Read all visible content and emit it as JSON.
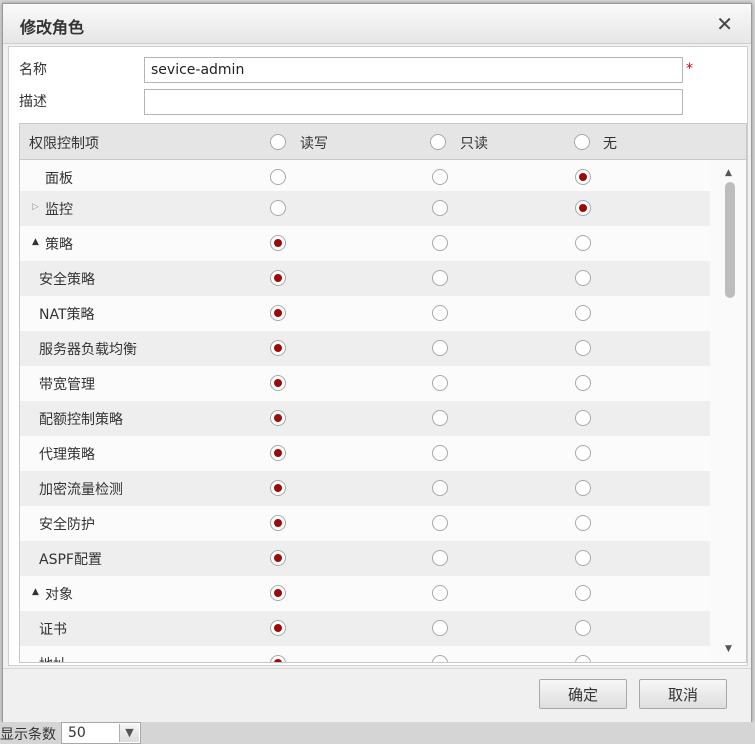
{
  "dialog": {
    "title": "修改角色",
    "close_glyph": "✕",
    "close_icon": "close-icon"
  },
  "form": {
    "name_label": "名称",
    "name_value": "sevice-admin",
    "required_mark": "*",
    "desc_label": "描述",
    "desc_value": ""
  },
  "permissions": {
    "header": {
      "label": "权限控制项",
      "columns": [
        "读写",
        "只读",
        "无"
      ]
    },
    "rows": [
      {
        "label": "面板",
        "level": 0,
        "group": false,
        "expanded": null,
        "selected": "无"
      },
      {
        "label": "监控",
        "level": 0,
        "group": true,
        "expanded": false,
        "selected": "无"
      },
      {
        "label": "策略",
        "level": 0,
        "group": true,
        "expanded": true,
        "selected": "读写"
      },
      {
        "label": "安全策略",
        "level": 1,
        "group": false,
        "expanded": null,
        "selected": "读写"
      },
      {
        "label": "NAT策略",
        "level": 1,
        "group": false,
        "expanded": null,
        "selected": "读写"
      },
      {
        "label": "服务器负载均衡",
        "level": 1,
        "group": false,
        "expanded": null,
        "selected": "读写"
      },
      {
        "label": "带宽管理",
        "level": 1,
        "group": false,
        "expanded": null,
        "selected": "读写"
      },
      {
        "label": "配额控制策略",
        "level": 1,
        "group": false,
        "expanded": null,
        "selected": "读写"
      },
      {
        "label": "代理策略",
        "level": 1,
        "group": false,
        "expanded": null,
        "selected": "读写"
      },
      {
        "label": "加密流量检测",
        "level": 1,
        "group": false,
        "expanded": null,
        "selected": "读写"
      },
      {
        "label": "安全防护",
        "level": 1,
        "group": false,
        "expanded": null,
        "selected": "读写"
      },
      {
        "label": "ASPF配置",
        "level": 1,
        "group": false,
        "expanded": null,
        "selected": "读写"
      },
      {
        "label": "对象",
        "level": 0,
        "group": true,
        "expanded": true,
        "selected": "读写"
      },
      {
        "label": "证书",
        "level": 1,
        "group": false,
        "expanded": null,
        "selected": "读写"
      },
      {
        "label": "地址",
        "level": 1,
        "group": false,
        "expanded": null,
        "selected": "读写"
      }
    ]
  },
  "buttons": {
    "ok": "确定",
    "cancel": "取消"
  },
  "pagination": {
    "label": "显示条数",
    "value": "50",
    "arrow_glyph": "▼"
  },
  "colors": {
    "radio_selected": "#9b0b0b",
    "required": "#dd0000"
  },
  "icons": {
    "expanded": "▲",
    "collapsed": "▷",
    "scroll_up": "▲",
    "scroll_down": "▼"
  }
}
